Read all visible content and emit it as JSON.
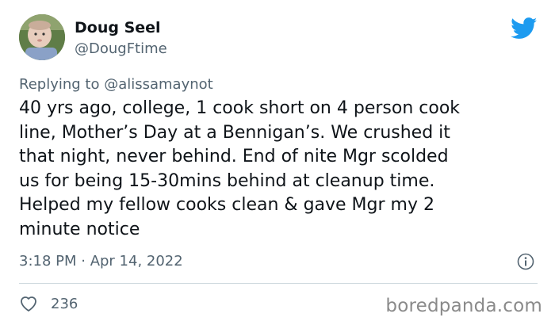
{
  "tweet": {
    "author_name": "Doug Seel",
    "author_handle": "@DougFtime",
    "replying_prefix": "Replying to ",
    "replying_to": "@alissamaynot",
    "text": "40 yrs ago, college, 1 cook short on 4 person cook\nline, Mother’s Day at a Bennigan’s. We crushed it\nthat night, never behind. End of nite Mgr scolded\nus for being 15-30mins behind at cleanup time.\nHelped my fellow cooks clean & gave Mgr my 2\nminute notice",
    "timestamp": "3:18 PM · Apr 14, 2022",
    "like_count": "236"
  },
  "icons": {
    "brand": "twitter-bird-icon",
    "info": "info-icon",
    "like": "heart-icon"
  },
  "colors": {
    "twitter_blue": "#1d9bf0",
    "secondary_text": "#536471",
    "divider": "#cfd9de"
  },
  "watermark": "boredpanda.com"
}
